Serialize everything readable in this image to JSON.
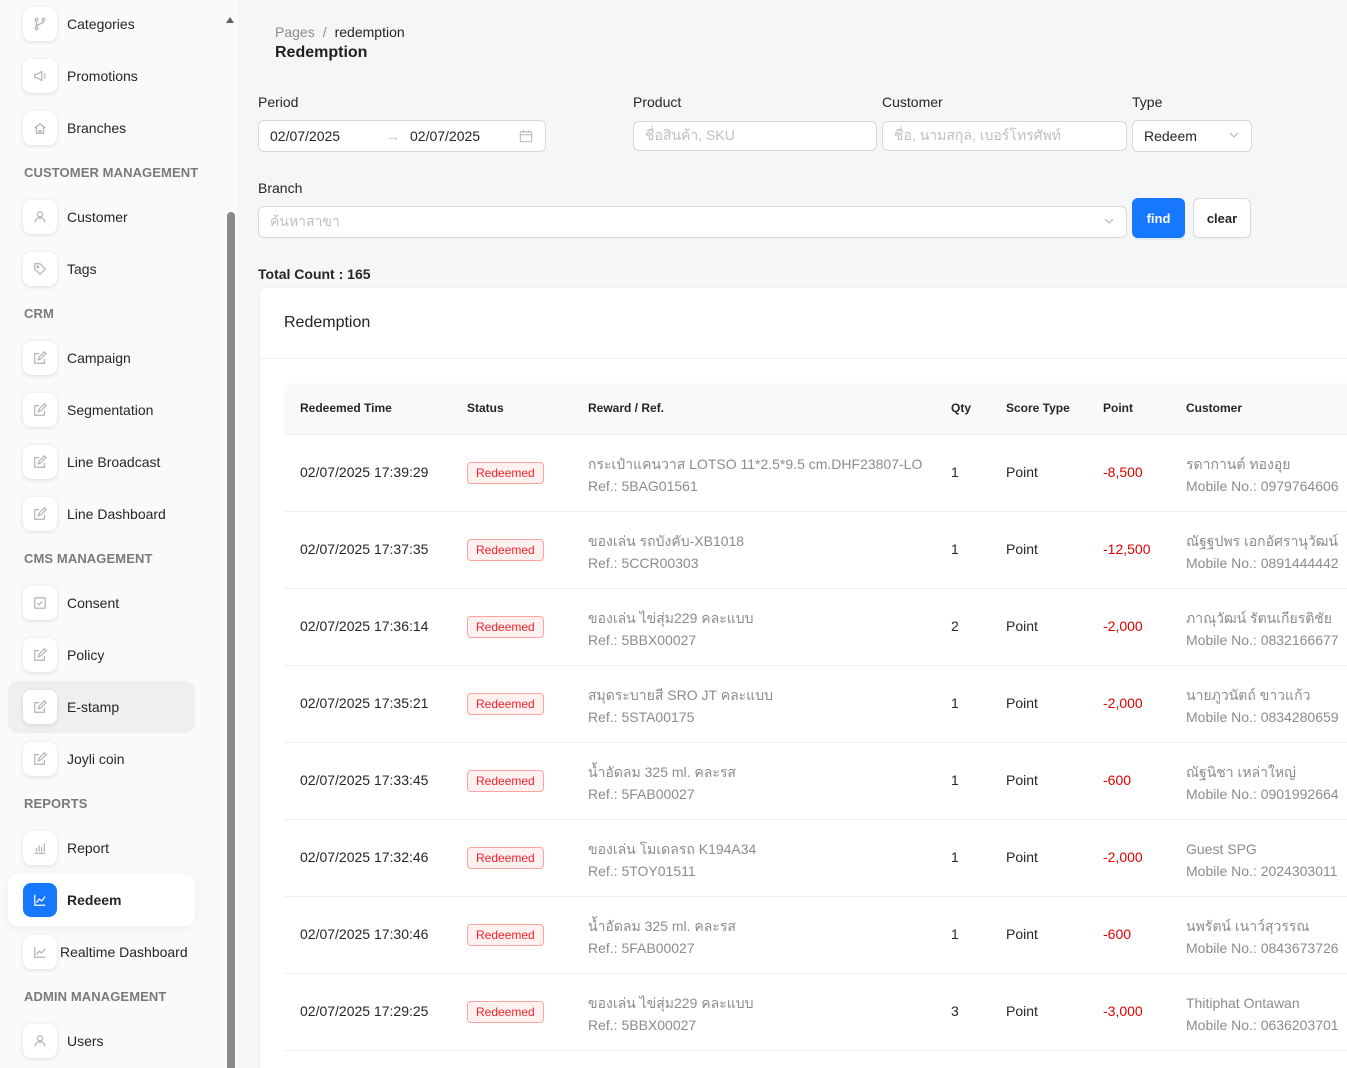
{
  "sidebar": {
    "sections": {
      "customer_management": "CUSTOMER MANAGEMENT",
      "crm": "CRM",
      "cms_management": "CMS MANAGEMENT",
      "reports": "REPORTS",
      "admin_management": "ADMIN MANAGEMENT"
    },
    "items": {
      "categories": "Categories",
      "promotions": "Promotions",
      "branches": "Branches",
      "customer": "Customer",
      "tags": "Tags",
      "campaign": "Campaign",
      "segmentation": "Segmentation",
      "line_broadcast": "Line Broadcast",
      "line_dashboard": "Line Dashboard",
      "consent": "Consent",
      "policy": "Policy",
      "e_stamp": "E-stamp",
      "joyli_coin": "Joyli coin",
      "report": "Report",
      "redeem": "Redeem",
      "realtime_dashboard": "Realtime Dashboard",
      "users": "Users"
    },
    "active_item": "Redeem"
  },
  "breadcrumb": {
    "root": "Pages",
    "separator": "/",
    "current": "redemption"
  },
  "page_title": "Redemption",
  "filters": {
    "period_label": "Period",
    "period_start": "02/07/2025",
    "period_end": "02/07/2025",
    "period_arrow": "→",
    "product_label": "Product",
    "product_placeholder": "ชื่อสินค้า, SKU",
    "customer_label": "Customer",
    "customer_placeholder": "ชื่อ, นามสกุล, เบอร์โทรศัพท์",
    "type_label": "Type",
    "type_value": "Redeem",
    "branch_label": "Branch",
    "branch_placeholder": "ค้นหาสาขา",
    "find_label": "find",
    "clear_label": "clear"
  },
  "total_count": "Total Count : 165",
  "card_title": "Redemption",
  "table": {
    "headers": {
      "time": "Redeemed Time",
      "status": "Status",
      "reward": "Reward / Ref.",
      "qty": "Qty",
      "score_type": "Score Type",
      "point": "Point",
      "customer": "Customer"
    },
    "rows": [
      {
        "time": "02/07/2025 17:39:29",
        "status": "Redeemed",
        "reward": "กระเป๋าแคนวาส LOTSO 11*2.5*9.5 cm.DHF23807-LO",
        "ref": "Ref.: 5BAG01561",
        "qty": "1",
        "score_type": "Point",
        "point": "-8,500",
        "customer": "รดากานต์ ทองอุย",
        "mobile": "Mobile No.: 0979764606"
      },
      {
        "time": "02/07/2025 17:37:35",
        "status": "Redeemed",
        "reward": "ของเล่น รถบังคับ-XB1018",
        "ref": "Ref.: 5CCR00303",
        "qty": "1",
        "score_type": "Point",
        "point": "-12,500",
        "customer": "ณัฐฐปพร เอกอัศรานุวัฒน์",
        "mobile": "Mobile No.: 0891444442"
      },
      {
        "time": "02/07/2025 17:36:14",
        "status": "Redeemed",
        "reward": "ของเล่น ไข่สุ่ม229 คละแบบ",
        "ref": "Ref.: 5BBX00027",
        "qty": "2",
        "score_type": "Point",
        "point": "-2,000",
        "customer": "ภาณุวัฒน์ รัตนเกียรติชัย",
        "mobile": "Mobile No.: 0832166677"
      },
      {
        "time": "02/07/2025 17:35:21",
        "status": "Redeemed",
        "reward": "สมุดระบายสี SRO JT คละแบบ",
        "ref": "Ref.: 5STA00175",
        "qty": "1",
        "score_type": "Point",
        "point": "-2,000",
        "customer": "นายภูวนัตถ์ ขาวแก้ว",
        "mobile": "Mobile No.: 0834280659"
      },
      {
        "time": "02/07/2025 17:33:45",
        "status": "Redeemed",
        "reward": "น้ำอัดลม 325 ml. คละรส",
        "ref": "Ref.: 5FAB00027",
        "qty": "1",
        "score_type": "Point",
        "point": "-600",
        "customer": "ณัฐนิชา เหล่าใหญ่",
        "mobile": "Mobile No.: 0901992664"
      },
      {
        "time": "02/07/2025 17:32:46",
        "status": "Redeemed",
        "reward": "ของเล่น โมเดลรถ K194A34",
        "ref": "Ref.: 5TOY01511",
        "qty": "1",
        "score_type": "Point",
        "point": "-2,000",
        "customer": "Guest SPG",
        "mobile": "Mobile No.: 2024303011"
      },
      {
        "time": "02/07/2025 17:30:46",
        "status": "Redeemed",
        "reward": "น้ำอัดลม 325 ml. คละรส",
        "ref": "Ref.: 5FAB00027",
        "qty": "1",
        "score_type": "Point",
        "point": "-600",
        "customer": "นพรัตน์ เนาว์สุวรรณ",
        "mobile": "Mobile No.: 0843673726"
      },
      {
        "time": "02/07/2025 17:29:25",
        "status": "Redeemed",
        "reward": "ของเล่น ไข่สุ่ม229 คละแบบ",
        "ref": "Ref.: 5BBX00027",
        "qty": "3",
        "score_type": "Point",
        "point": "-3,000",
        "customer": "Thitiphat Ontawan",
        "mobile": "Mobile No.: 0636203701"
      }
    ]
  },
  "icons": {
    "categories": "branch-icon",
    "promotions": "megaphone-icon",
    "branches": "home-icon",
    "customer": "user-icon",
    "tags": "tag-icon",
    "edit": "edit-icon",
    "consent": "checkbox-icon",
    "report": "bar-chart-icon",
    "redeem": "line-chart-icon",
    "users": "user-icon"
  },
  "colors": {
    "primary": "#1677ff",
    "negative": "#e00000",
    "tag_red": "#f5222d"
  }
}
